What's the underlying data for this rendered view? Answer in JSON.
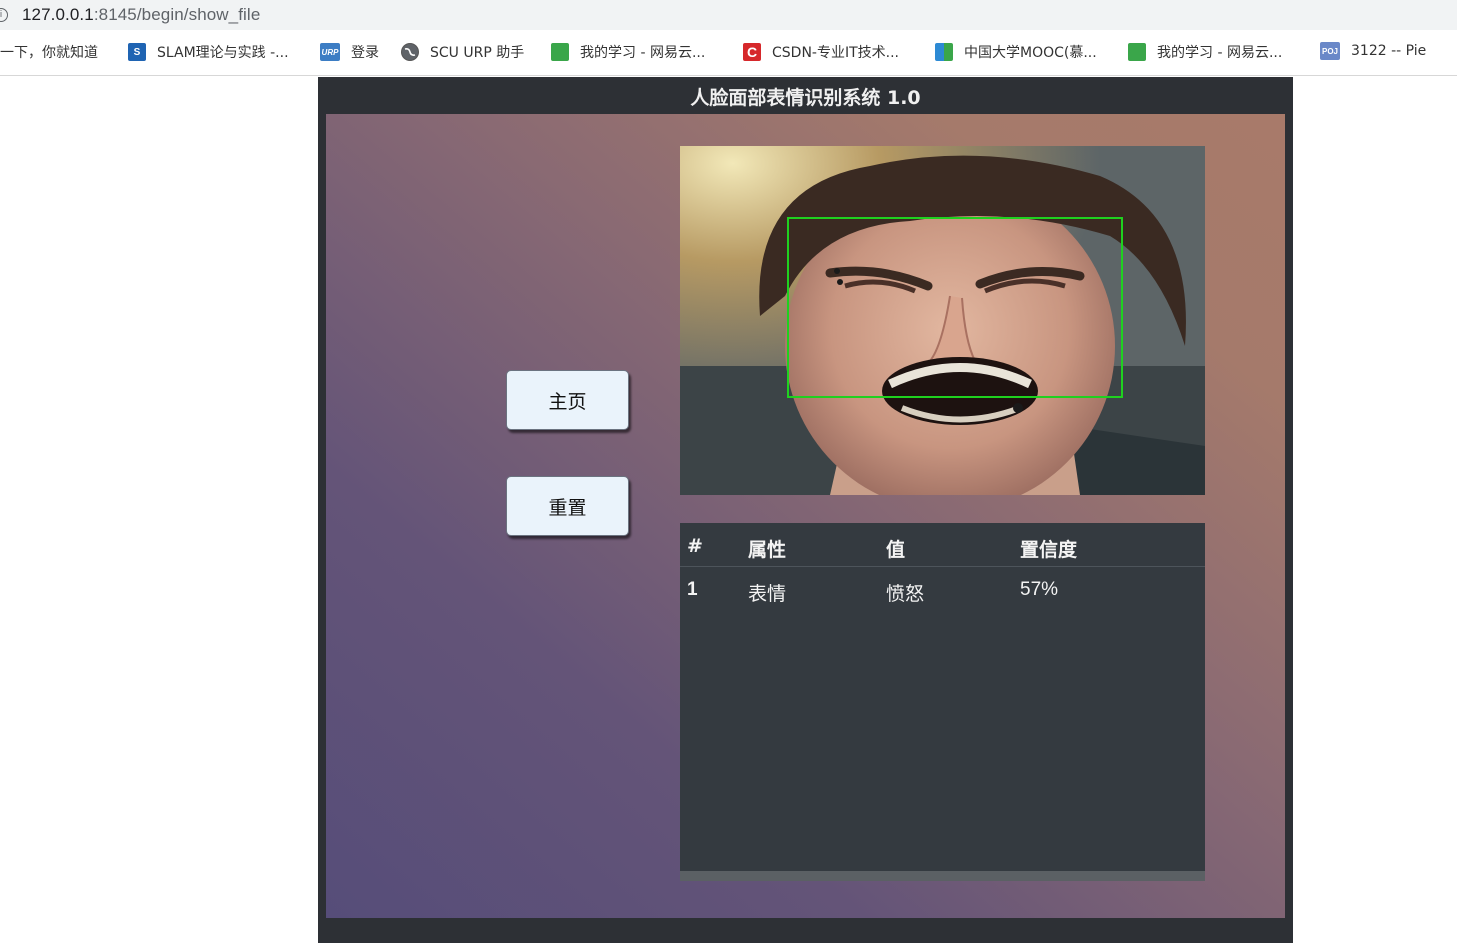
{
  "browser": {
    "url_host": "127.0.0.1",
    "url_path": ":8145/begin/show_file",
    "bookmarks": [
      {
        "label": "度一下，你就知道",
        "icon": "paw-icon"
      },
      {
        "label": "SLAM理论与实践 -...",
        "icon": "s-logo-icon",
        "color": "#2a6bb5"
      },
      {
        "label": "登录",
        "icon": "urp-icon",
        "color": "#3c7dc4"
      },
      {
        "label": "SCU URP 助手",
        "icon": "globe-icon"
      },
      {
        "label": "我的学习 - 网易云...",
        "icon": "book-icon",
        "color": "#3aa64a"
      },
      {
        "label": "CSDN-专业IT技术...",
        "icon": "csdn-icon",
        "color": "#d6282b"
      },
      {
        "label": "中国大学MOOC(慕...",
        "icon": "mooc-icon",
        "color": "#2d8ad4"
      },
      {
        "label": "我的学习 - 网易云...",
        "icon": "book-icon",
        "color": "#3aa64a"
      },
      {
        "label": "3122 -- Pie",
        "icon": "poj-icon",
        "color": "#6a88c8"
      }
    ]
  },
  "app": {
    "title": "人脸面部表情识别系统 1.0",
    "buttons": {
      "home": "主页",
      "reset": "重置"
    },
    "results": {
      "headers": [
        "#",
        "属性",
        "值",
        "置信度"
      ],
      "rows": [
        [
          "1",
          "表情",
          "愤怒",
          "57%"
        ]
      ]
    }
  },
  "colors": {
    "header_bg": "#2d3035",
    "table_bg": "#343a40",
    "face_box": "#1fd11f",
    "button_bg": "#eaf3fb"
  }
}
